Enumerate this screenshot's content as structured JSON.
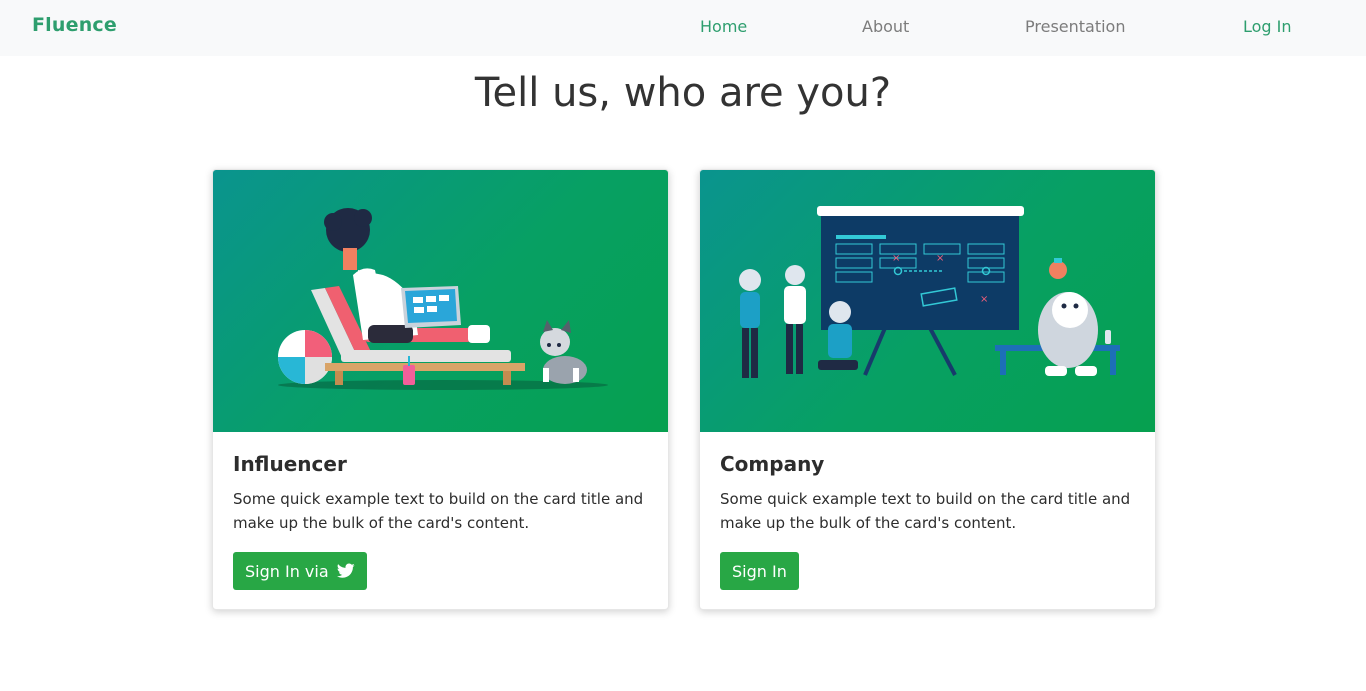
{
  "navbar": {
    "brand": "Fluence",
    "links": [
      {
        "label": "Home",
        "active": true
      },
      {
        "label": "About"
      },
      {
        "label": "Presentation"
      },
      {
        "label": "Log In"
      }
    ]
  },
  "page": {
    "heading": "Tell us, who are you?"
  },
  "cards": [
    {
      "title": "Influencer",
      "text": "Some quick example text to build on the card title and make up the bulk of the card's content.",
      "button_label": "Sign In via",
      "button_icon": "twitter-icon"
    },
    {
      "title": "Company",
      "text": "Some quick example text to build on the card title and make up the bulk of the card's content.",
      "button_label": "Sign In"
    }
  ],
  "colors": {
    "brand": "#2e9e6e",
    "button": "#28a745",
    "card_image_gradient": [
      "#0a948e",
      "#06a04f"
    ]
  }
}
